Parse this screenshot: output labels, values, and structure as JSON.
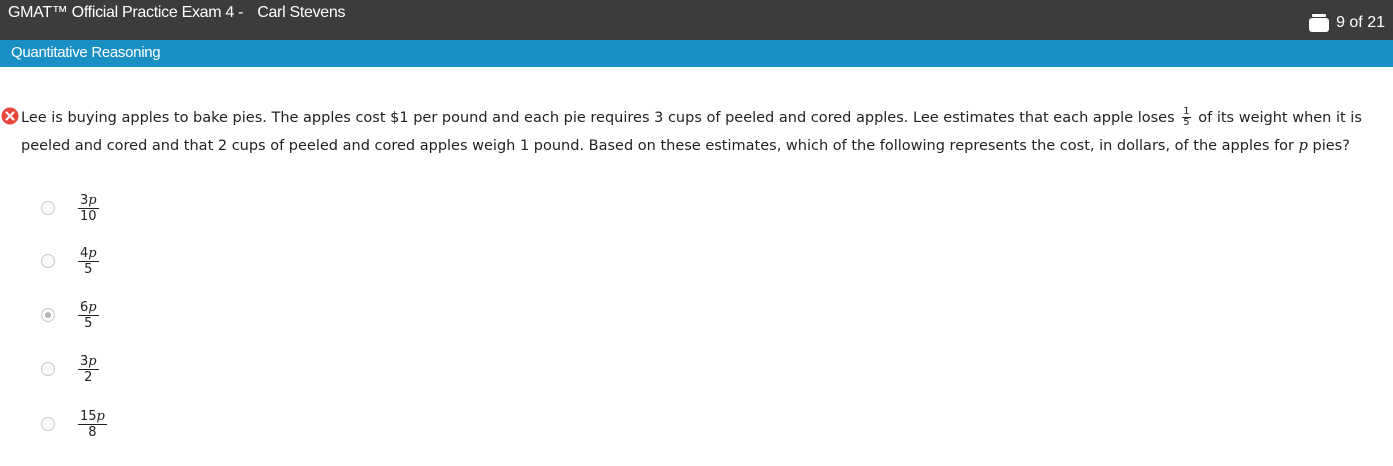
{
  "header": {
    "exam_title": "GMAT™ Official Practice Exam 4 -",
    "candidate_name": "Carl Stevens",
    "progress": "9 of 21",
    "calculator_icon": "calculator-icon"
  },
  "section": {
    "title": "Quantitative Reasoning"
  },
  "question": {
    "status_icon": "wrong-answer-icon",
    "text_part1": "Lee is buying apples to bake pies. The apples cost $1 per pound and each pie requires 3 cups of peeled and cored apples. Lee estimates that each apple loses",
    "fraction_num": "1",
    "fraction_den": "5",
    "text_part2": "of its weight when it is peeled and cored and that 2 cups of peeled and cored apples weigh 1 pound. Based on these estimates, which of the following represents the cost, in dollars, of the apples for",
    "variable": "p",
    "text_part3": "pies?"
  },
  "choices": [
    {
      "num": "3p",
      "den": "10",
      "selected": false
    },
    {
      "num": "4p",
      "den": "5",
      "selected": false
    },
    {
      "num": "6p",
      "den": "5",
      "selected": true
    },
    {
      "num": "3p",
      "den": "2",
      "selected": false
    },
    {
      "num": "15p",
      "den": "8",
      "selected": false
    }
  ]
}
